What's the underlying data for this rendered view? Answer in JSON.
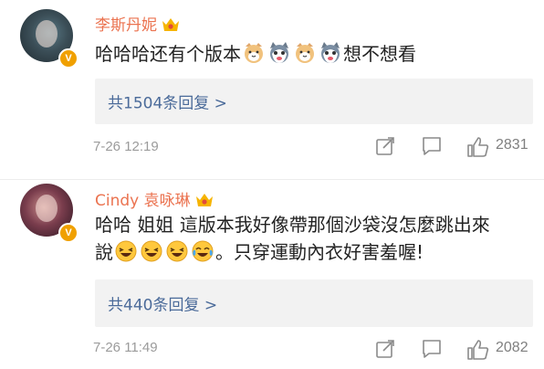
{
  "colors": {
    "username": "#eb7350",
    "replies_link": "#4b6b9a",
    "meta": "#9b9b9b",
    "badge": "#f0a000"
  },
  "comments": [
    {
      "username": "李斯丹妮",
      "text_parts": [
        "哈哈哈还有个版本",
        "想不想看"
      ],
      "emojis": [
        "cat-face-emoji",
        "husky-emoji",
        "cat-face-emoji",
        "husky-emoji"
      ],
      "replies_label": "共1504条回复 >",
      "date": "7-26 12:19",
      "like_count": "2831"
    },
    {
      "username": "Cindy 袁咏琳",
      "text_line1": "哈哈 姐姐 這版本我好像帶那個沙袋沒怎麼跳出來",
      "text_line2_start": "說",
      "text_line2_end": "。只穿運動內衣好害羞喔!",
      "emojis": [
        "laughing-emoji",
        "laughing-emoji",
        "laughing-emoji",
        "tears-of-joy-emoji"
      ],
      "replies_label": "共440条回复 >",
      "date": "7-26 11:49",
      "like_count": "2082"
    }
  ]
}
